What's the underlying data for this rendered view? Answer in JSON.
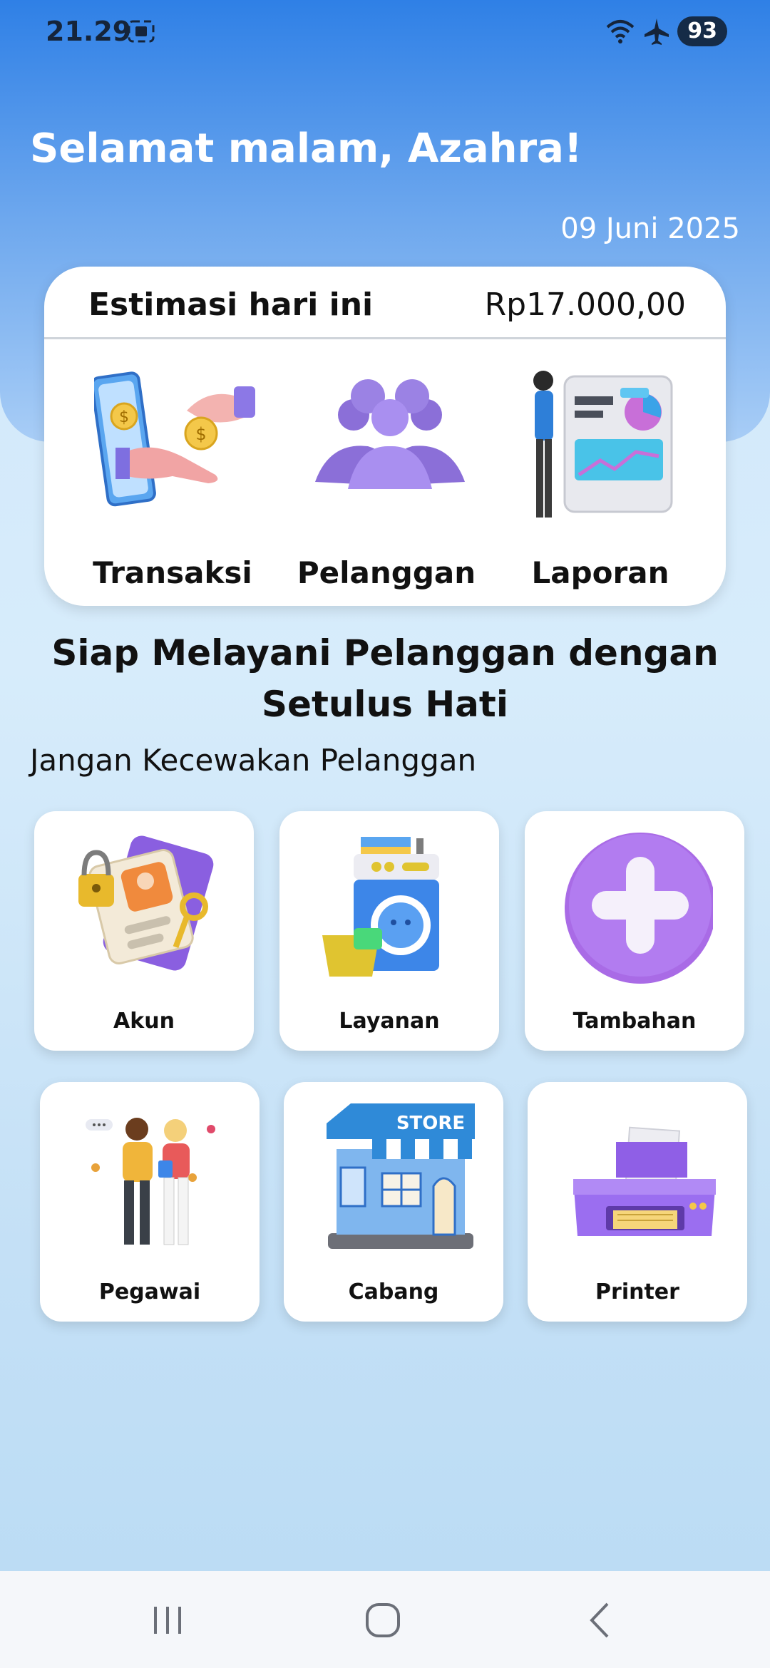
{
  "status_bar": {
    "time": "21.29",
    "battery": "93"
  },
  "header": {
    "greeting": "Selamat malam, Azahra!",
    "date": "09 Juni 2025"
  },
  "estimate_card": {
    "label": "Estimasi hari ini",
    "value": "Rp17.000,00",
    "menu": [
      {
        "label": "Transaksi",
        "icon": "transaction-icon"
      },
      {
        "label": "Pelanggan",
        "icon": "customers-icon"
      },
      {
        "label": "Laporan",
        "icon": "report-icon"
      }
    ]
  },
  "slogan": {
    "line1": "Siap Melayani Pelanggan dengan",
    "line2": "Setulus Hati",
    "subtitle": "Jangan Kecewakan Pelanggan"
  },
  "tiles": [
    {
      "label": "Akun",
      "icon": "account-icon"
    },
    {
      "label": "Layanan",
      "icon": "washing-machine-icon"
    },
    {
      "label": "Tambahan",
      "icon": "plus-icon"
    },
    {
      "label": "Pegawai",
      "icon": "employees-icon"
    },
    {
      "label": "Cabang",
      "icon": "store-icon"
    },
    {
      "label": "Printer",
      "icon": "printer-icon"
    }
  ],
  "colors": {
    "primary": "#2f80e6",
    "accent_purple": "#9b6fe0",
    "text": "#111111"
  }
}
